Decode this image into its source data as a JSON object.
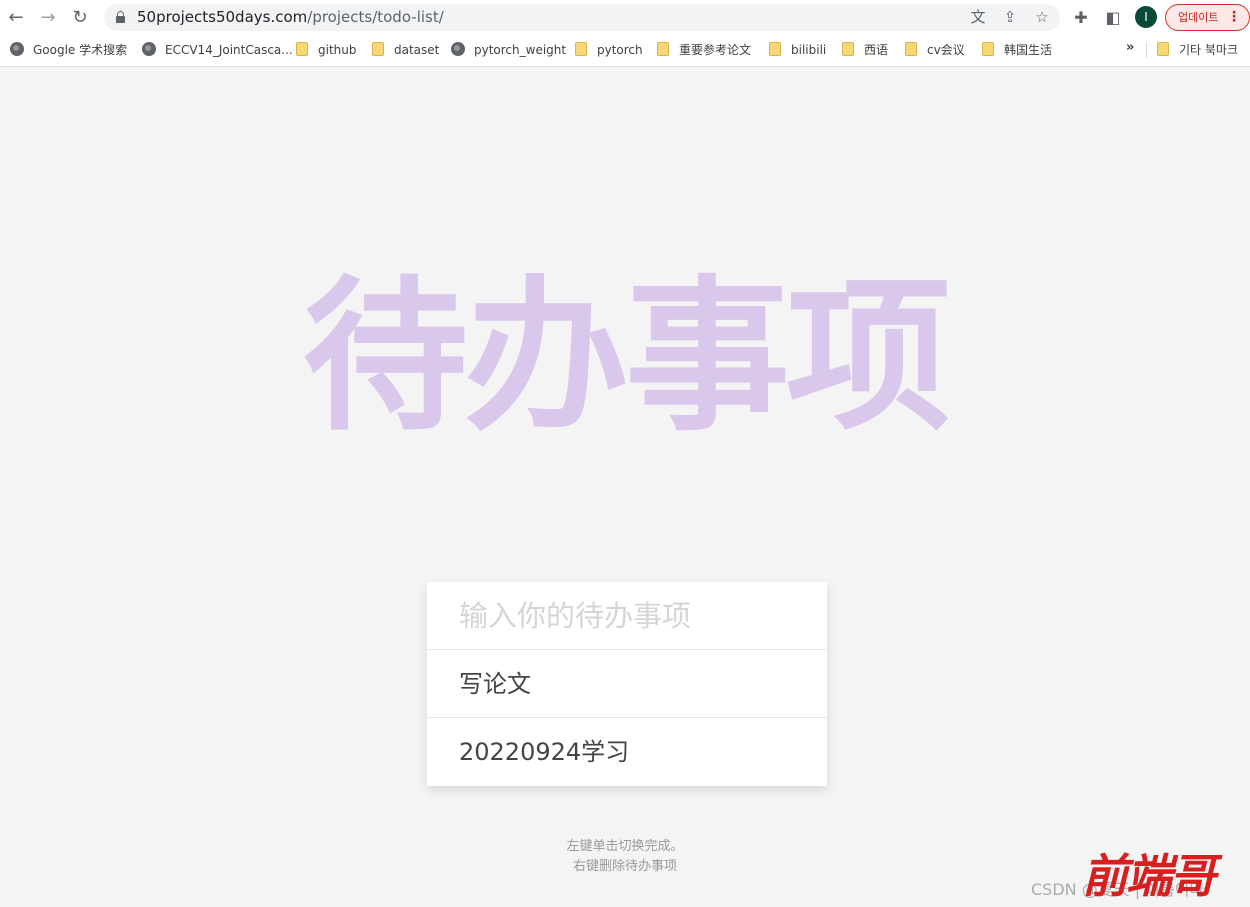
{
  "browser": {
    "url_host": "50projects50days.com",
    "url_path": "/projects/todo-list/",
    "avatar_letter": "I",
    "update_label": "업데이트",
    "icons": {
      "back": "back-arrow-icon",
      "forward": "forward-arrow-icon",
      "reload": "reload-icon",
      "lock": "lock-icon",
      "translate": "translate-icon",
      "share": "share-icon",
      "star": "star-icon",
      "extensions": "puzzle-icon",
      "sidepanel": "side-panel-icon",
      "menu": "kebab-menu-icon"
    }
  },
  "bookmarks": {
    "items": [
      {
        "label": "Google 学术搜索",
        "icon": "globe-icon"
      },
      {
        "label": "ECCV14_JointCasca...",
        "icon": "globe-icon"
      },
      {
        "label": "github",
        "icon": "folder-icon"
      },
      {
        "label": "dataset",
        "icon": "folder-icon"
      },
      {
        "label": "pytorch_weight",
        "icon": "globe-icon"
      },
      {
        "label": "pytorch",
        "icon": "folder-icon"
      },
      {
        "label": "重要参考论文",
        "icon": "folder-icon"
      },
      {
        "label": "bilibili",
        "icon": "folder-icon"
      },
      {
        "label": "西语",
        "icon": "folder-icon"
      },
      {
        "label": "cv会议",
        "icon": "folder-icon"
      },
      {
        "label": "韩国生活",
        "icon": "folder-icon"
      }
    ],
    "more_label": "»",
    "other_label": "기타 북마크"
  },
  "page": {
    "title": "待办事项",
    "input_placeholder": "输入你的待办事项",
    "todos": [
      {
        "text": "写论文",
        "completed": false
      },
      {
        "text": "20220924学习",
        "completed": false
      }
    ],
    "hint_line1": "左键单击切换完成。",
    "hint_line2": "右键删除待办事项",
    "watermark": "CSDN @夏天 | 여름이다",
    "seal_text": "前端哥"
  },
  "colors": {
    "background": "#f4f4f4",
    "title": "#d9c8ec",
    "seal": "#d81e1e"
  }
}
